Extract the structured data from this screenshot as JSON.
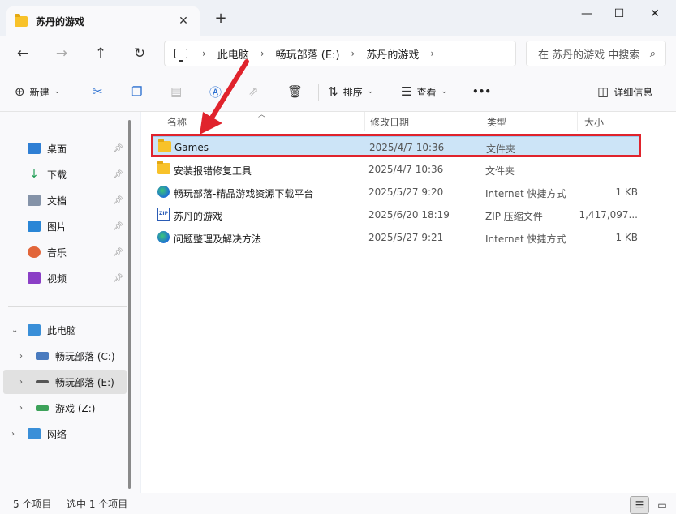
{
  "window": {
    "tab_title": "苏丹的游戏",
    "new_tab": "+",
    "controls": {
      "minimize": "—",
      "maximize": "☐",
      "close": "✕"
    }
  },
  "nav": {
    "breadcrumb": [
      "此电脑",
      "畅玩部落 (E:)",
      "苏丹的游戏"
    ],
    "search_placeholder": "在 苏丹的游戏 中搜索"
  },
  "toolbar": {
    "new_label": "新建",
    "sort_label": "排序",
    "view_label": "查看",
    "more_label": "•••",
    "details_label": "详细信息"
  },
  "sidebar": {
    "quick_access": [
      {
        "label": "桌面",
        "icon": "desktop-icon",
        "color": "#2f7fd4"
      },
      {
        "label": "下载",
        "icon": "download-icon",
        "color": "#1f9d55"
      },
      {
        "label": "文档",
        "icon": "document-icon",
        "color": "#7a8aa0"
      },
      {
        "label": "图片",
        "icon": "picture-icon",
        "color": "#2a86d6"
      },
      {
        "label": "音乐",
        "icon": "music-icon",
        "color": "#e2663a"
      },
      {
        "label": "视频",
        "icon": "video-icon",
        "color": "#8b3fc6"
      }
    ],
    "this_pc": "此电脑",
    "drives": [
      {
        "label": "畅玩部落 (C:)"
      },
      {
        "label": "畅玩部落 (E:)"
      },
      {
        "label": "游戏 (Z:)"
      }
    ],
    "network": "网络"
  },
  "columns": [
    "名称",
    "修改日期",
    "类型",
    "大小"
  ],
  "files": [
    {
      "name": "Games",
      "date": "2025/4/7 10:36",
      "type": "文件夹",
      "size": "",
      "icon": "folder-icon"
    },
    {
      "name": "安装报错修复工具",
      "date": "2025/4/7 10:36",
      "type": "文件夹",
      "size": "",
      "icon": "folder-icon"
    },
    {
      "name": "畅玩部落-精品游戏资源下载平台",
      "date": "2025/5/27 9:20",
      "type": "Internet 快捷方式",
      "size": "1 KB",
      "icon": "shortcut-icon"
    },
    {
      "name": "苏丹的游戏",
      "date": "2025/6/20 18:19",
      "type": "ZIP 压缩文件",
      "size": "1,417,097...",
      "icon": "zip-icon"
    },
    {
      "name": "问题整理及解决方法",
      "date": "2025/5/27 9:21",
      "type": "Internet 快捷方式",
      "size": "1 KB",
      "icon": "shortcut-icon"
    }
  ],
  "status": {
    "count": "5 个项目",
    "selected": "选中 1 个项目"
  },
  "colors": {
    "selection": "#cce4f7",
    "annotation_red": "#e0232c"
  }
}
